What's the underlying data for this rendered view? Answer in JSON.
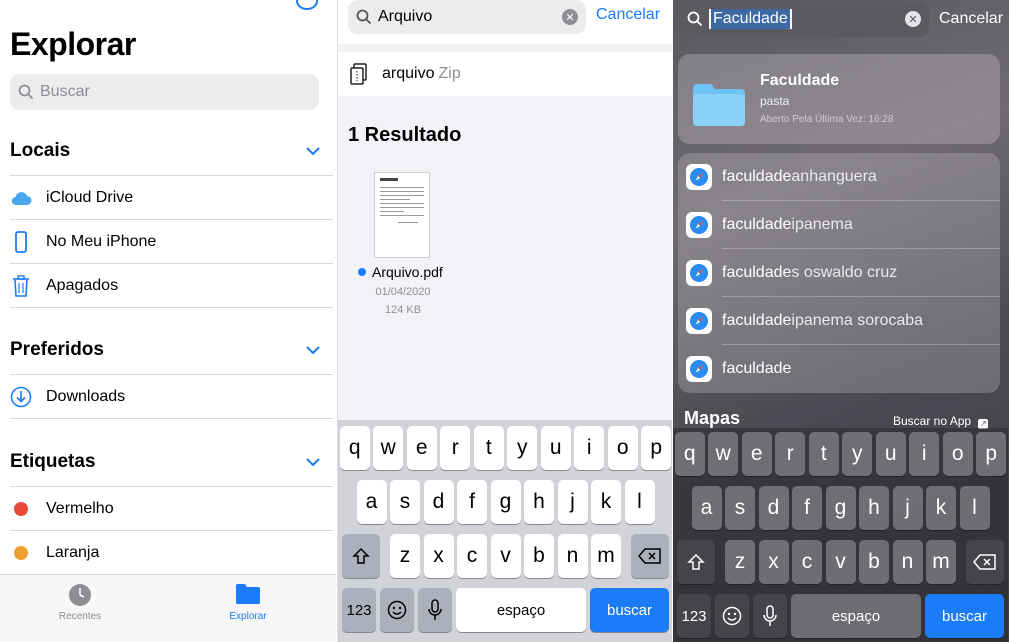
{
  "files_explore": {
    "title": "Explorar",
    "search_placeholder": "Buscar",
    "sections": {
      "locais": "Locais",
      "preferidos": "Preferidos",
      "etiquetas": "Etiquetas"
    },
    "locais_items": [
      "iCloud Drive",
      "No Meu iPhone",
      "Apagados"
    ],
    "preferidos_items": [
      "Downloads"
    ],
    "etiquetas_items": [
      {
        "label": "Vermelho",
        "color": "#e9473a"
      },
      {
        "label": "Laranja",
        "color": "#f0a030"
      }
    ],
    "tabs": {
      "recentes": "Recentes",
      "explorar": "Explorar"
    }
  },
  "files_search": {
    "query": "Arquivo",
    "cancel": "Cancelar",
    "suggestion_main": "arquivo",
    "suggestion_kind": "Zip",
    "results_title": "1 Resultado",
    "file_name": "Arquivo.pdf",
    "file_date": "01/04/2020",
    "file_size": "124 KB"
  },
  "spotlight": {
    "query": "Faculdade",
    "cancel": "Cancelar",
    "top_hit": {
      "title": "Faculdade",
      "subtitle": "pasta",
      "opened": "Aberto Pela Última Vez: 16:28"
    },
    "suggestions": [
      {
        "bold": "faculdade",
        "rest": " anhanguera"
      },
      {
        "bold": "faculdade",
        "rest": " ipanema"
      },
      {
        "bold": "faculdade",
        "rest": "s oswaldo cruz"
      },
      {
        "bold": "faculdade",
        "rest": " ipanema sorocaba"
      },
      {
        "bold": "faculdade",
        "rest": ""
      }
    ],
    "section_maps": "Mapas",
    "search_in_app": "Buscar no App"
  },
  "keyboard": {
    "row1": [
      "q",
      "w",
      "e",
      "r",
      "t",
      "y",
      "u",
      "i",
      "o",
      "p"
    ],
    "row2": [
      "a",
      "s",
      "d",
      "f",
      "g",
      "h",
      "j",
      "k",
      "l"
    ],
    "row3": [
      "z",
      "x",
      "c",
      "v",
      "b",
      "n",
      "m"
    ],
    "numbers": "123",
    "space": "espaço",
    "go": "buscar"
  },
  "colors": {
    "accent": "#1a7cf6"
  }
}
